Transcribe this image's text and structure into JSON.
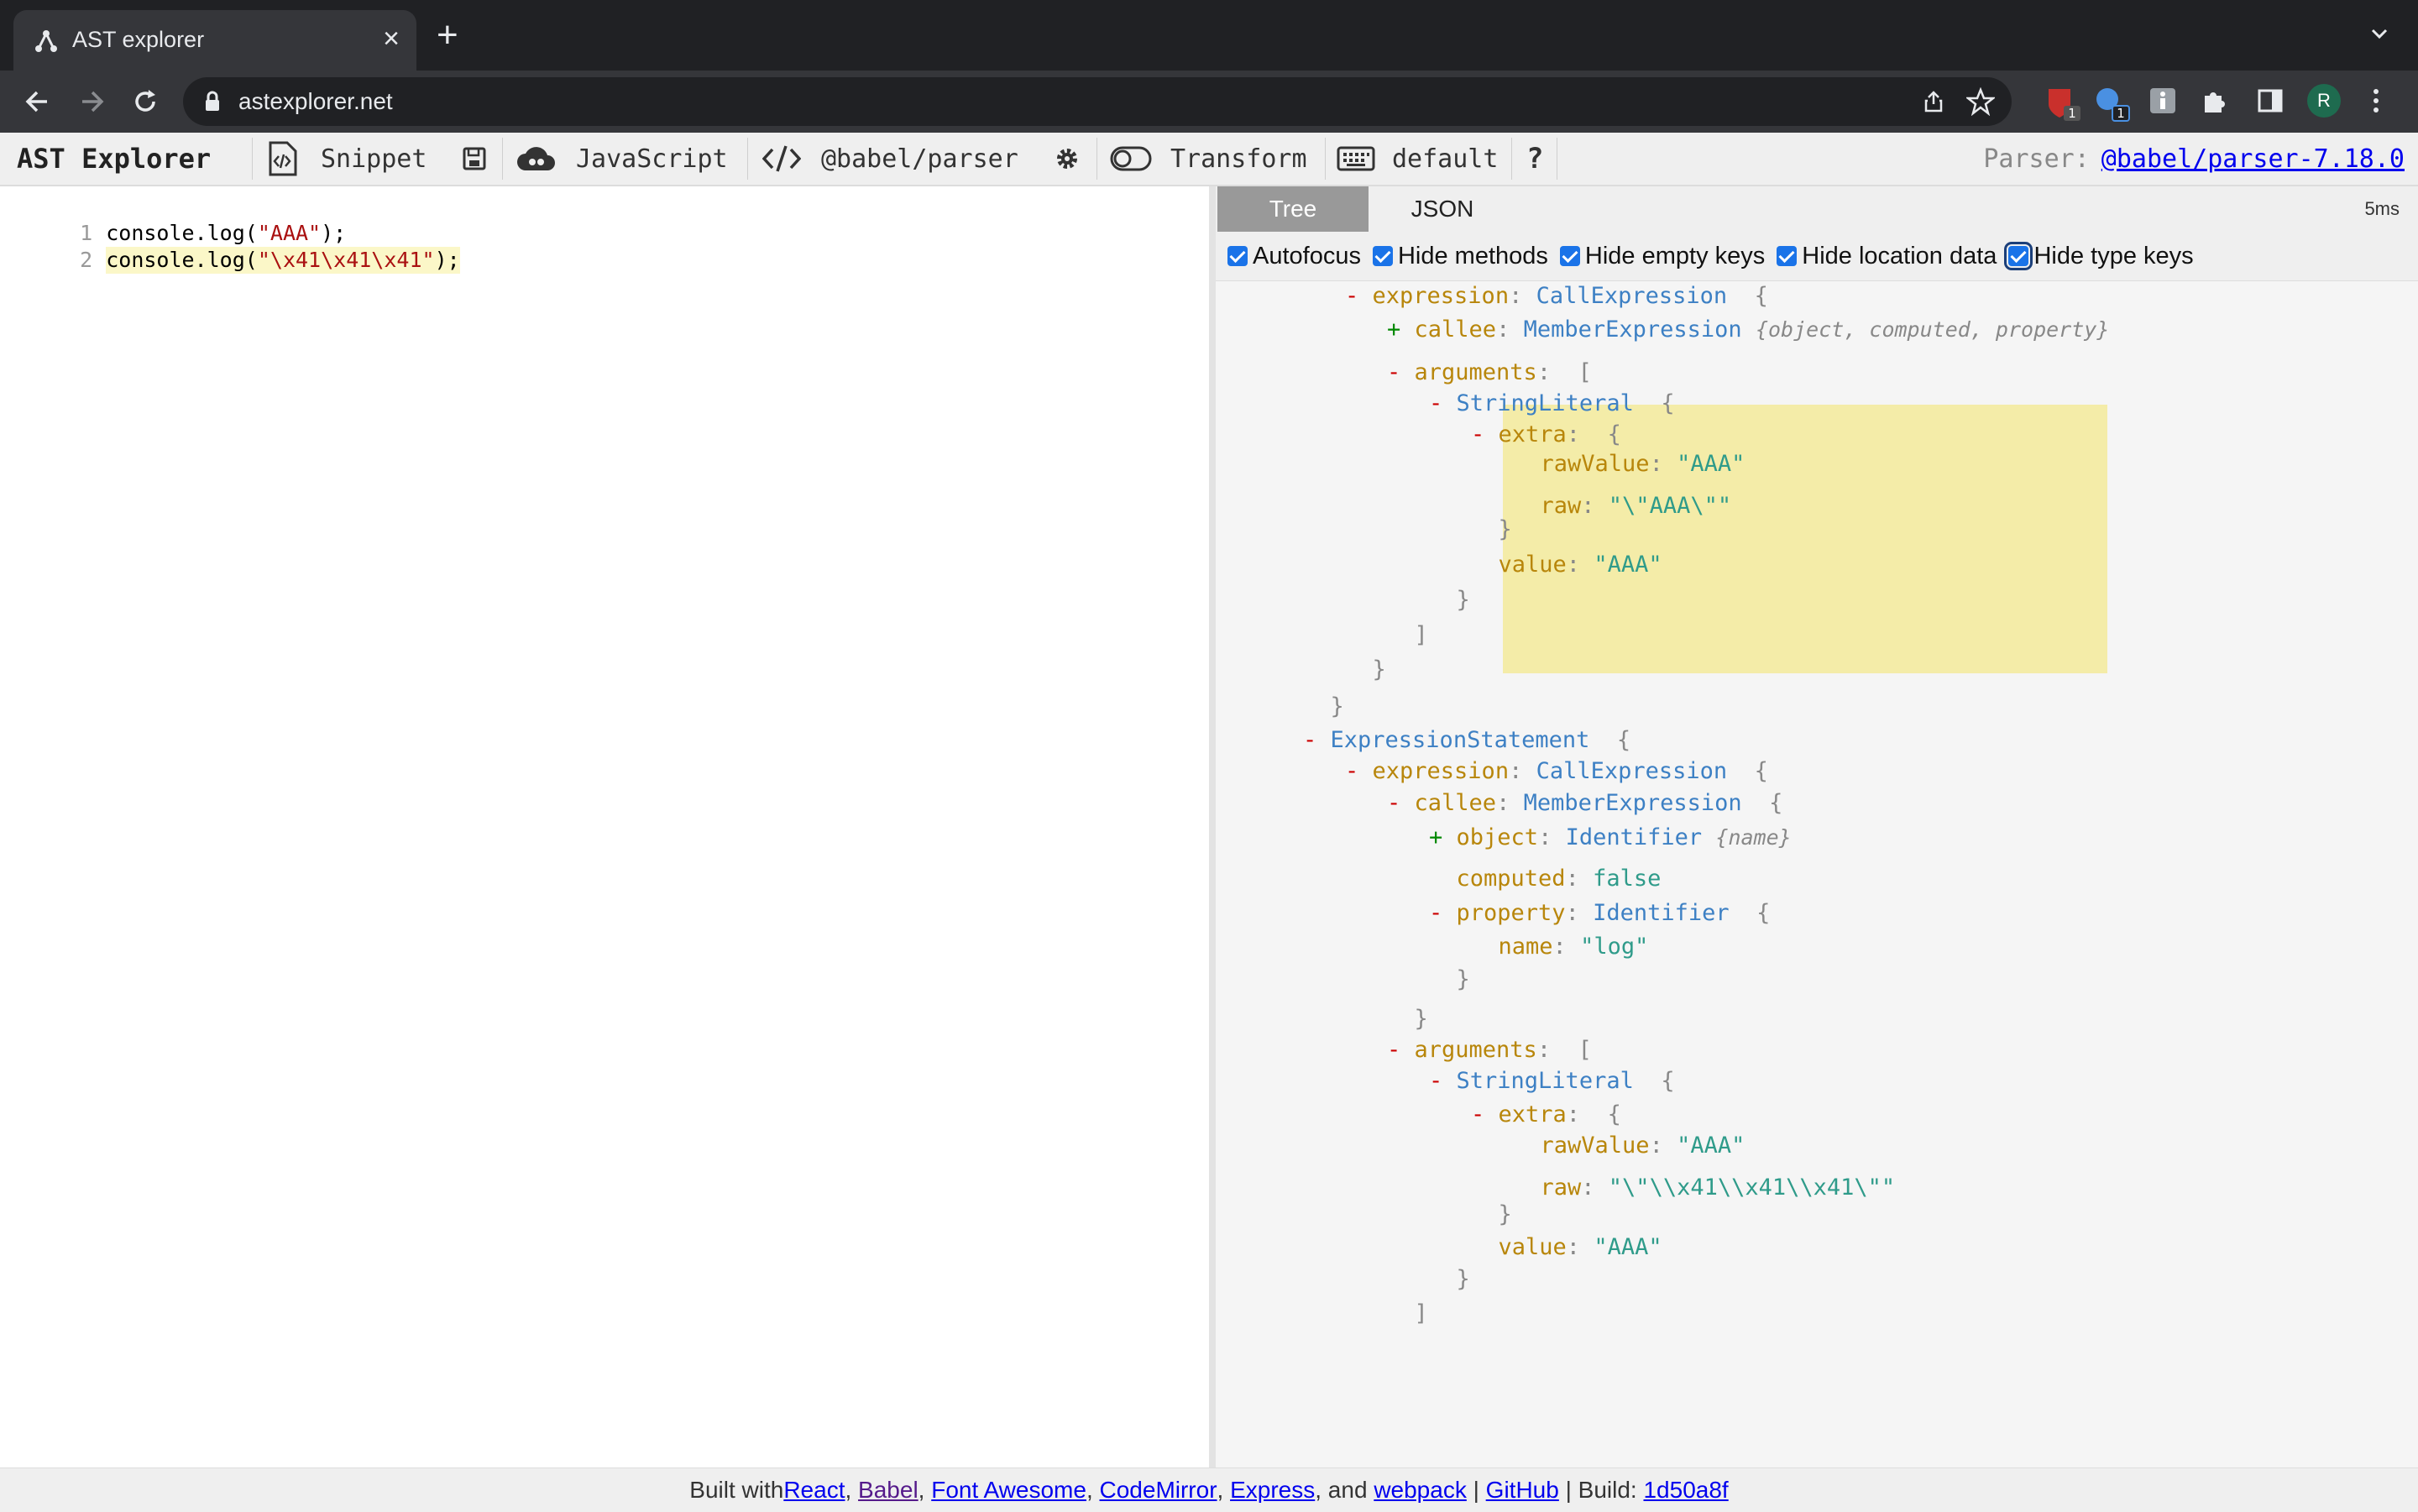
{
  "browser": {
    "tab_title": "AST explorer",
    "url": "astexplorer.net",
    "profile_initial": "R",
    "ext_badge_1": "1",
    "ext_badge_2": "1"
  },
  "toolbar": {
    "brand": "AST Explorer",
    "snippet": "Snippet",
    "language": "JavaScript",
    "parser": "@babel/parser",
    "transform": "Transform",
    "keymap": "default",
    "help": "?",
    "parser_label": "Parser:",
    "parser_version": "@babel/parser-7.18.0"
  },
  "editor": {
    "lines": [
      {
        "num": "1",
        "pre": "console.log(",
        "str": "\"AAA\"",
        "post": ");"
      },
      {
        "num": "2",
        "pre": "console.log(",
        "str": "\"\\x41\\x41\\x41\"",
        "post": ");"
      }
    ]
  },
  "output": {
    "tabs": [
      "Tree",
      "JSON"
    ],
    "timing": "5ms",
    "options": [
      "Autofocus",
      "Hide methods",
      "Hide empty keys",
      "Hide location data",
      "Hide type keys"
    ],
    "tree": [
      {
        "indent": 2,
        "parts": [
          [
            "tog",
            "- "
          ],
          [
            "key",
            "expression"
          ],
          [
            "brace",
            ": "
          ],
          [
            "typ",
            "CallExpression"
          ],
          [
            "brace",
            "  {"
          ]
        ]
      },
      {
        "indent": 3,
        "parts": [
          [
            "togp",
            "+ "
          ],
          [
            "key",
            "callee"
          ],
          [
            "brace",
            ": "
          ],
          [
            "typ",
            "MemberExpression"
          ],
          [
            "brace",
            " "
          ],
          [
            "sum",
            "{object, computed, property}"
          ]
        ]
      },
      {
        "indent": 3,
        "parts": [
          [
            "tog",
            "- "
          ],
          [
            "key",
            "arguments"
          ],
          [
            "brace",
            ":  ["
          ]
        ]
      },
      {
        "indent": 4,
        "parts": [
          [
            "tog",
            "- "
          ],
          [
            "typ",
            "StringLiteral"
          ],
          [
            "brace",
            "  {"
          ]
        ]
      },
      {
        "indent": 5,
        "parts": [
          [
            "tog",
            "- "
          ],
          [
            "key",
            "extra"
          ],
          [
            "brace",
            ":  {"
          ]
        ]
      },
      {
        "indent": 6,
        "parts": [
          [
            "key",
            "  rawValue"
          ],
          [
            "brace",
            ": "
          ],
          [
            "sv",
            "\"AAA\""
          ]
        ]
      },
      {
        "indent": 6,
        "parts": [
          [
            "key",
            "  raw"
          ],
          [
            "brace",
            ": "
          ],
          [
            "sv",
            "\"\\\"AAA\\\"\""
          ]
        ]
      },
      {
        "indent": 5,
        "parts": [
          [
            "brace",
            "  }"
          ]
        ]
      },
      {
        "indent": 5,
        "parts": [
          [
            "key",
            "  value"
          ],
          [
            "brace",
            ": "
          ],
          [
            "sv",
            "\"AAA\""
          ]
        ]
      },
      {
        "indent": 4,
        "parts": [
          [
            "brace",
            "  }"
          ]
        ]
      },
      {
        "indent": 3,
        "parts": [
          [
            "brace",
            "  ]"
          ]
        ]
      },
      {
        "indent": 2,
        "parts": [
          [
            "brace",
            "  }"
          ]
        ]
      },
      {
        "indent": 1,
        "parts": [
          [
            "brace",
            "  }"
          ]
        ]
      },
      {
        "indent": 1,
        "parts": [
          [
            "tog",
            "- "
          ],
          [
            "typ",
            "ExpressionStatement"
          ],
          [
            "brace",
            "  {"
          ]
        ]
      },
      {
        "indent": 2,
        "parts": [
          [
            "tog",
            "- "
          ],
          [
            "key",
            "expression"
          ],
          [
            "brace",
            ": "
          ],
          [
            "typ",
            "CallExpression"
          ],
          [
            "brace",
            "  {"
          ]
        ]
      },
      {
        "indent": 3,
        "parts": [
          [
            "tog",
            "- "
          ],
          [
            "key",
            "callee"
          ],
          [
            "brace",
            ": "
          ],
          [
            "typ",
            "MemberExpression"
          ],
          [
            "brace",
            "  {"
          ]
        ]
      },
      {
        "indent": 4,
        "parts": [
          [
            "togp",
            "+ "
          ],
          [
            "key",
            "object"
          ],
          [
            "brace",
            ": "
          ],
          [
            "typ",
            "Identifier"
          ],
          [
            "brace",
            " "
          ],
          [
            "sum",
            "{name}"
          ]
        ]
      },
      {
        "indent": 4,
        "parts": [
          [
            "key",
            "  computed"
          ],
          [
            "brace",
            ": "
          ],
          [
            "sv",
            "false"
          ]
        ]
      },
      {
        "indent": 4,
        "parts": [
          [
            "tog",
            "- "
          ],
          [
            "key",
            "property"
          ],
          [
            "brace",
            ": "
          ],
          [
            "typ",
            "Identifier"
          ],
          [
            "brace",
            "  {"
          ]
        ]
      },
      {
        "indent": 5,
        "parts": [
          [
            "key",
            "  name"
          ],
          [
            "brace",
            ": "
          ],
          [
            "sv",
            "\"log\""
          ]
        ]
      },
      {
        "indent": 4,
        "parts": [
          [
            "brace",
            "  }"
          ]
        ]
      },
      {
        "indent": 3,
        "parts": [
          [
            "brace",
            "  }"
          ]
        ]
      },
      {
        "indent": 3,
        "parts": [
          [
            "tog",
            "- "
          ],
          [
            "key",
            "arguments"
          ],
          [
            "brace",
            ":  ["
          ]
        ]
      },
      {
        "indent": 4,
        "parts": [
          [
            "tog",
            "- "
          ],
          [
            "typ",
            "StringLiteral"
          ],
          [
            "brace",
            "  {"
          ]
        ]
      },
      {
        "indent": 5,
        "parts": [
          [
            "tog",
            "- "
          ],
          [
            "key",
            "extra"
          ],
          [
            "brace",
            ":  {"
          ]
        ]
      },
      {
        "indent": 6,
        "parts": [
          [
            "key",
            "  rawValue"
          ],
          [
            "brace",
            ": "
          ],
          [
            "sv",
            "\"AAA\""
          ]
        ]
      },
      {
        "indent": 6,
        "parts": [
          [
            "key",
            "  raw"
          ],
          [
            "brace",
            ": "
          ],
          [
            "sv",
            "\"\\\"\\\\x41\\\\x41\\\\x41\\\"\""
          ]
        ]
      },
      {
        "indent": 5,
        "parts": [
          [
            "brace",
            "  }"
          ]
        ]
      },
      {
        "indent": 5,
        "parts": [
          [
            "key",
            "  value"
          ],
          [
            "brace",
            ": "
          ],
          [
            "sv",
            "\"AAA\""
          ]
        ]
      },
      {
        "indent": 4,
        "parts": [
          [
            "brace",
            "  }"
          ]
        ]
      },
      {
        "indent": 3,
        "parts": [
          [
            "brace",
            "  ]"
          ]
        ]
      }
    ]
  },
  "footer": {
    "built_with": "Built with ",
    "links": [
      "React",
      "Babel",
      "Font Awesome",
      "CodeMirror",
      "Express"
    ],
    "and": ", and ",
    "webpack": "webpack",
    "sep1": " | ",
    "github": "GitHub",
    "sep2": " | Build: ",
    "build": "1d50a8f"
  },
  "colors": {
    "accent": "#1a73e8",
    "highlight": "#f4eca8"
  }
}
